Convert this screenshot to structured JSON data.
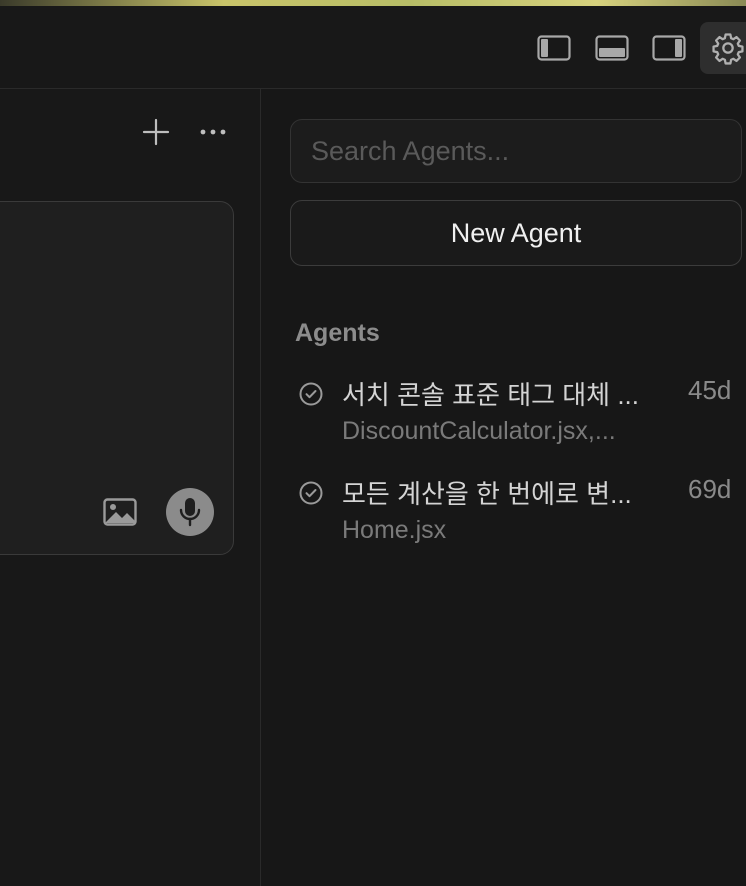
{
  "titlebar": {
    "buttons": [
      {
        "name": "toggle-left-sidebar",
        "icon": "sidebar-left-icon"
      },
      {
        "name": "toggle-bottom-panel",
        "icon": "panel-bottom-icon"
      },
      {
        "name": "toggle-right-sidebar",
        "icon": "sidebar-right-icon"
      },
      {
        "name": "settings",
        "icon": "gear-icon",
        "active": true
      }
    ]
  },
  "chat": {
    "add_icon": "plus-icon",
    "more_icon": "ellipsis-icon",
    "image_icon": "image-icon",
    "mic_icon": "microphone-icon"
  },
  "agents_panel": {
    "search_placeholder": "Search Agents...",
    "new_agent_label": "New Agent",
    "section_title": "Agents",
    "items": [
      {
        "title": "서치 콘솔 표준 태그 대체 ...",
        "subtitle": "DiscountCalculator.jsx,...",
        "age": "45d",
        "status_icon": "check-circle-icon"
      },
      {
        "title": "모든 계산을 한 번에로 변...",
        "subtitle": "Home.jsx",
        "age": "69d",
        "status_icon": "check-circle-icon"
      }
    ]
  },
  "colors": {
    "background": "#171717",
    "accent_gray": "#8b8b8b"
  }
}
